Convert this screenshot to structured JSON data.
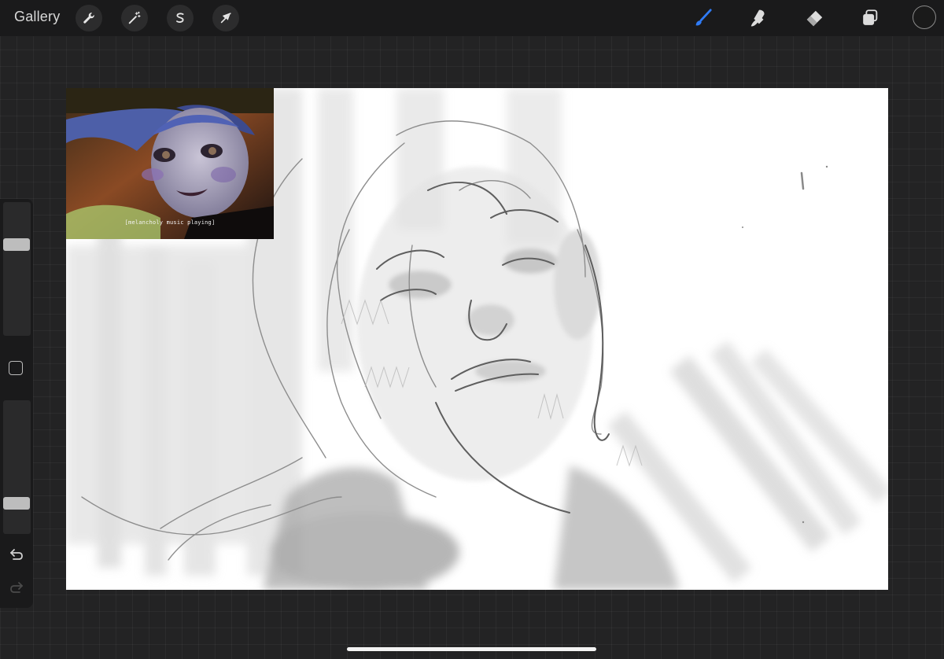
{
  "topbar": {
    "gallery_label": "Gallery",
    "left_tools": [
      {
        "name": "actions",
        "icon": "wrench-icon"
      },
      {
        "name": "adjustments",
        "icon": "magic-wand-icon"
      },
      {
        "name": "selection",
        "icon": "selection-s-icon"
      },
      {
        "name": "transform",
        "icon": "arrow-cursor-icon"
      }
    ],
    "right_tools": [
      {
        "name": "brush",
        "icon": "brush-icon",
        "active": true
      },
      {
        "name": "smudge",
        "icon": "smudge-icon"
      },
      {
        "name": "eraser",
        "icon": "eraser-icon"
      },
      {
        "name": "layers",
        "icon": "layers-icon"
      }
    ],
    "current_color": "#1a1a1a",
    "accent_color": "#2f7bf5"
  },
  "reference": {
    "caption": "[melancholy music playing]"
  },
  "sidebar": {
    "brush_size_level": 0.7,
    "opacity_level": 0.2,
    "modify_icon": "square-icon",
    "undo_icon": "undo-icon",
    "redo_icon": "redo-icon"
  }
}
